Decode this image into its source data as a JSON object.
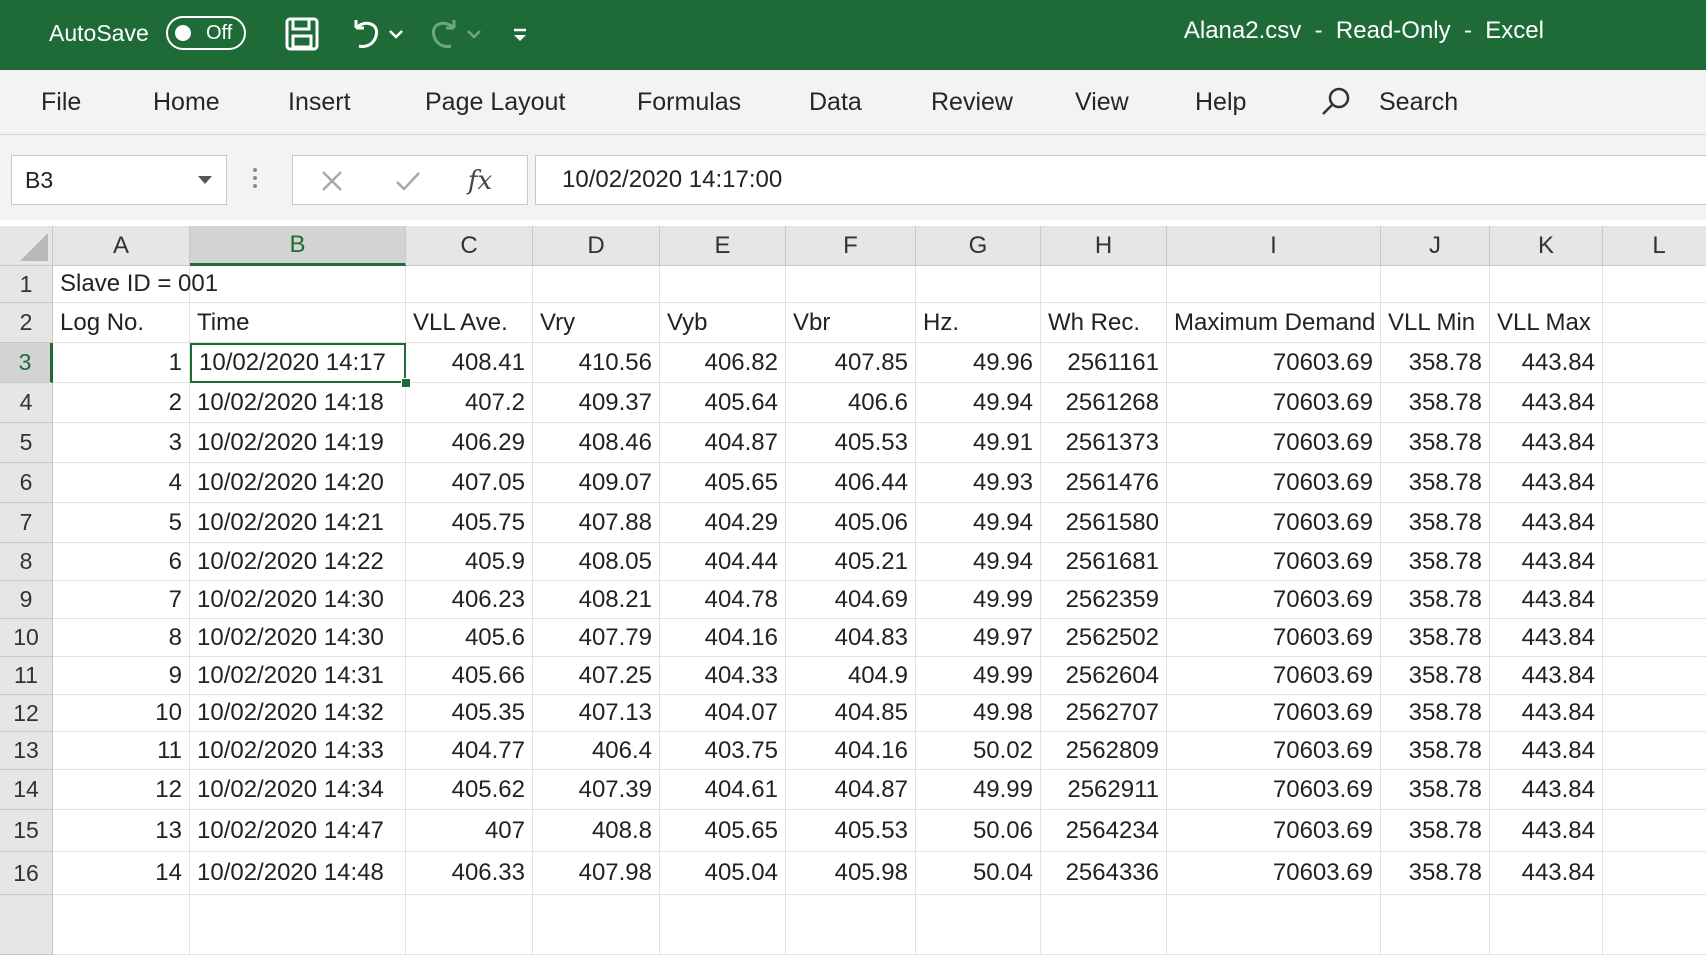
{
  "titlebar": {
    "autosave_label": "AutoSave",
    "autosave_state": "Off",
    "document_title": "Alana2.csv  -  Read-Only  -  Excel",
    "icons": [
      "save-icon",
      "undo-icon",
      "undo-dropdown-icon",
      "redo-icon",
      "redo-dropdown-icon",
      "customize-toolbar-icon"
    ]
  },
  "ribbon": {
    "tabs": [
      "File",
      "Home",
      "Insert",
      "Page Layout",
      "Formulas",
      "Data",
      "Review",
      "View",
      "Help"
    ],
    "search_label": "Search"
  },
  "formula_bar": {
    "name_box": "B3",
    "fx_label": "fx",
    "formula": "10/02/2020  14:17:00"
  },
  "sheet": {
    "columns": [
      "A",
      "B",
      "C",
      "D",
      "E",
      "F",
      "G",
      "H",
      "I",
      "J",
      "K",
      "L"
    ],
    "selected_column": "B",
    "selected_row": "3",
    "active_cell": "B3",
    "rows": [
      {
        "num": "1",
        "cells": [
          "Slave ID = 001",
          "",
          "",
          "",
          "",
          "",
          "",
          "",
          "",
          "",
          "",
          ""
        ]
      },
      {
        "num": "2",
        "cells": [
          "Log No.",
          "Time",
          "VLL Ave.",
          "Vry",
          "Vyb",
          "Vbr",
          "Hz.",
          "Wh Rec.",
          "Maximum Demand",
          "VLL Min",
          "VLL Max",
          ""
        ]
      },
      {
        "num": "3",
        "cells": [
          "1",
          "10/02/2020 14:17",
          "408.41",
          "410.56",
          "406.82",
          "407.85",
          "49.96",
          "2561161",
          "70603.69",
          "358.78",
          "443.84",
          ""
        ]
      },
      {
        "num": "4",
        "cells": [
          "2",
          "10/02/2020 14:18",
          "407.2",
          "409.37",
          "405.64",
          "406.6",
          "49.94",
          "2561268",
          "70603.69",
          "358.78",
          "443.84",
          ""
        ]
      },
      {
        "num": "5",
        "cells": [
          "3",
          "10/02/2020 14:19",
          "406.29",
          "408.46",
          "404.87",
          "405.53",
          "49.91",
          "2561373",
          "70603.69",
          "358.78",
          "443.84",
          ""
        ]
      },
      {
        "num": "6",
        "cells": [
          "4",
          "10/02/2020 14:20",
          "407.05",
          "409.07",
          "405.65",
          "406.44",
          "49.93",
          "2561476",
          "70603.69",
          "358.78",
          "443.84",
          ""
        ]
      },
      {
        "num": "7",
        "cells": [
          "5",
          "10/02/2020 14:21",
          "405.75",
          "407.88",
          "404.29",
          "405.06",
          "49.94",
          "2561580",
          "70603.69",
          "358.78",
          "443.84",
          ""
        ]
      },
      {
        "num": "8",
        "cells": [
          "6",
          "10/02/2020 14:22",
          "405.9",
          "408.05",
          "404.44",
          "405.21",
          "49.94",
          "2561681",
          "70603.69",
          "358.78",
          "443.84",
          ""
        ]
      },
      {
        "num": "9",
        "cells": [
          "7",
          "10/02/2020 14:30",
          "406.23",
          "408.21",
          "404.78",
          "404.69",
          "49.99",
          "2562359",
          "70603.69",
          "358.78",
          "443.84",
          ""
        ]
      },
      {
        "num": "10",
        "cells": [
          "8",
          "10/02/2020 14:30",
          "405.6",
          "407.79",
          "404.16",
          "404.83",
          "49.97",
          "2562502",
          "70603.69",
          "358.78",
          "443.84",
          ""
        ]
      },
      {
        "num": "11",
        "cells": [
          "9",
          "10/02/2020 14:31",
          "405.66",
          "407.25",
          "404.33",
          "404.9",
          "49.99",
          "2562604",
          "70603.69",
          "358.78",
          "443.84",
          ""
        ]
      },
      {
        "num": "12",
        "cells": [
          "10",
          "10/02/2020 14:32",
          "405.35",
          "407.13",
          "404.07",
          "404.85",
          "49.98",
          "2562707",
          "70603.69",
          "358.78",
          "443.84",
          ""
        ]
      },
      {
        "num": "13",
        "cells": [
          "11",
          "10/02/2020 14:33",
          "404.77",
          "406.4",
          "403.75",
          "404.16",
          "50.02",
          "2562809",
          "70603.69",
          "358.78",
          "443.84",
          ""
        ]
      },
      {
        "num": "14",
        "cells": [
          "12",
          "10/02/2020 14:34",
          "405.62",
          "407.39",
          "404.61",
          "404.87",
          "49.99",
          "2562911",
          "70603.69",
          "358.78",
          "443.84",
          ""
        ]
      },
      {
        "num": "15",
        "cells": [
          "13",
          "10/02/2020 14:47",
          "407",
          "408.8",
          "405.65",
          "405.53",
          "50.06",
          "2564234",
          "70603.69",
          "358.78",
          "443.84",
          ""
        ]
      },
      {
        "num": "16",
        "cells": [
          "14",
          "10/02/2020 14:48",
          "406.33",
          "407.98",
          "405.04",
          "405.98",
          "50.04",
          "2564336",
          "70603.69",
          "358.78",
          "443.84",
          ""
        ]
      },
      {
        "num": "",
        "cells": [
          "",
          "",
          "",
          "",
          "",
          "",
          "",
          "",
          "",
          "",
          "",
          ""
        ]
      }
    ]
  },
  "colors": {
    "excel_green": "#1e6b38",
    "ribbon_bg": "#f3f3f3",
    "header_bg": "#e6e6e6"
  }
}
